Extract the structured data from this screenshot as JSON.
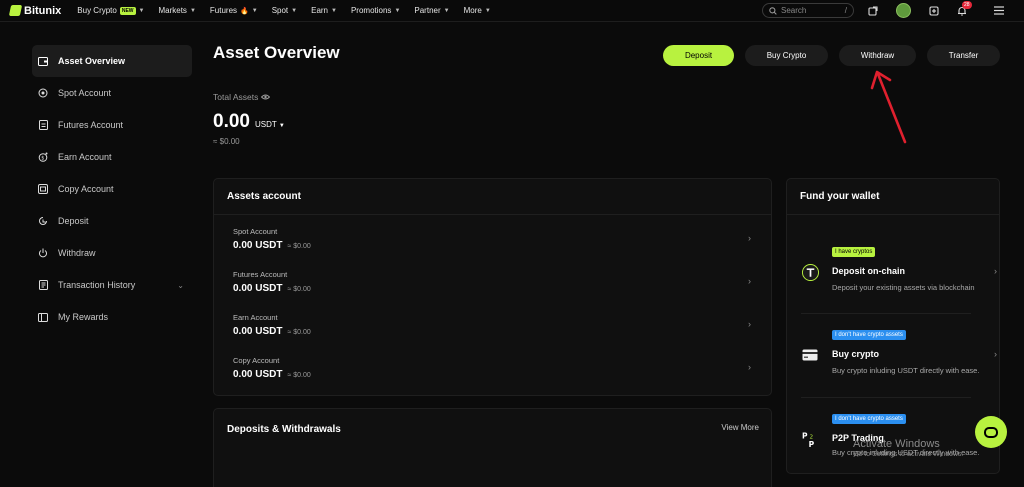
{
  "brand": {
    "name": "Bitunix"
  },
  "nav": [
    {
      "label": "Buy Crypto",
      "badge": "NEW"
    },
    {
      "label": "Markets"
    },
    {
      "label": "Futures",
      "flame": true
    },
    {
      "label": "Spot"
    },
    {
      "label": "Earn"
    },
    {
      "label": "Promotions"
    },
    {
      "label": "Partner"
    },
    {
      "label": "More"
    }
  ],
  "search": {
    "placeholder": "Search",
    "shortcut": "/"
  },
  "notifications": {
    "count": "28"
  },
  "sidebar": [
    {
      "label": "Asset Overview",
      "icon": "wallet-icon",
      "active": true
    },
    {
      "label": "Spot Account",
      "icon": "spot-icon"
    },
    {
      "label": "Futures Account",
      "icon": "futures-icon"
    },
    {
      "label": "Earn Account",
      "icon": "earn-icon"
    },
    {
      "label": "Copy Account",
      "icon": "copy-icon"
    },
    {
      "label": "Deposit",
      "icon": "deposit-icon"
    },
    {
      "label": "Withdraw",
      "icon": "withdraw-icon"
    },
    {
      "label": "Transaction History",
      "icon": "history-icon",
      "expandable": true
    },
    {
      "label": "My Rewards",
      "icon": "rewards-icon"
    }
  ],
  "page": {
    "title": "Asset Overview",
    "actions": {
      "deposit": "Deposit",
      "buy_crypto": "Buy Crypto",
      "withdraw": "Withdraw",
      "transfer": "Transfer"
    }
  },
  "total": {
    "label": "Total Assets",
    "amount": "0.00",
    "unit": "USDT",
    "approx": "≈ $0.00"
  },
  "assets_account": {
    "title": "Assets account",
    "rows": [
      {
        "name": "Spot Account",
        "value": "0.00 USDT",
        "sub": "≈ $0.00"
      },
      {
        "name": "Futures Account",
        "value": "0.00 USDT",
        "sub": "≈ $0.00"
      },
      {
        "name": "Earn Account",
        "value": "0.00 USDT",
        "sub": "≈ $0.00"
      },
      {
        "name": "Copy Account",
        "value": "0.00 USDT",
        "sub": "≈ $0.00"
      }
    ]
  },
  "deposits_withdrawals": {
    "title": "Deposits & Withdrawals",
    "view_more": "View More"
  },
  "fund_wallet": {
    "title": "Fund your wallet",
    "items": [
      {
        "tag": "I have cryptos",
        "title": "Deposit on-chain",
        "desc": "Deposit your existing assets via blockchain"
      },
      {
        "tag": "I don't have crypto assets",
        "title": "Buy crypto",
        "desc": "Buy crypto inluding USDT directly with ease."
      },
      {
        "tag": "I don't have crypto assets",
        "title": "P2P Trading",
        "desc": "Buy crypto inluding USDT directly with ease."
      }
    ]
  },
  "watermark": {
    "line1": "Activate Windows",
    "line2": "Go to Settings to activate Windows."
  },
  "colors": {
    "accent": "#b8f23f",
    "tag_blue": "#2b8ff0",
    "annotation_arrow": "#e0202e",
    "notification": "#e5283a"
  }
}
